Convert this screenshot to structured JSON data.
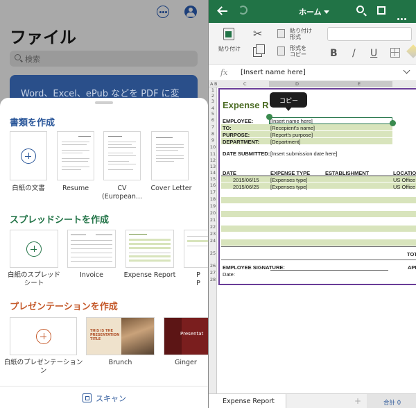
{
  "left": {
    "title": "ファイル",
    "search_placeholder": "検索",
    "banner_text": "Word、Excel、ePub などを PDF に変",
    "sections": {
      "documents": {
        "title": "書類を作成",
        "items": [
          {
            "label": "白紙の文書"
          },
          {
            "label": "Resume"
          },
          {
            "label": "CV",
            "label2": "(European..."
          },
          {
            "label": "Cover Letter"
          }
        ]
      },
      "spreadsheets": {
        "title": "スプレッドシートを作成",
        "items": [
          {
            "label": "白紙のスプレッド",
            "label2": "シート"
          },
          {
            "label": "Invoice"
          },
          {
            "label": "Expense Report"
          },
          {
            "label": "P",
            "label2": "P"
          }
        ]
      },
      "presentations": {
        "title": "プレゼンテーションを作成",
        "items": [
          {
            "label": "白紙のプレゼンテーション",
            "label2": "ン"
          },
          {
            "label": "Brunch",
            "thumb_text": "THIS IS THE PRESENTATION TITLE"
          },
          {
            "label": "Ginger",
            "thumb_text": "Presentat"
          }
        ]
      }
    },
    "scan_label": "スキャン"
  },
  "right": {
    "toolbar": {
      "home_label": "ホーム"
    },
    "ribbon": {
      "paste_label": "貼り付け",
      "paste_format_label1": "貼り付け",
      "paste_format_label2": "形式",
      "format_copy_label1": "形式を",
      "format_copy_label2": "コピー",
      "bold": "B",
      "italic": "/",
      "underline": "U"
    },
    "formula": {
      "fx": "fx",
      "value": "[Insert name here]"
    },
    "columns": {
      "a": "A",
      "b": "B",
      "c": "C",
      "d": "D",
      "e": "E"
    },
    "rows": [
      "1",
      "2",
      "3",
      "4",
      "5",
      "6",
      "7",
      "8",
      "9",
      "10",
      "11",
      "12",
      "13",
      "14",
      "15",
      "16",
      "17",
      "18",
      "19",
      "20",
      "21",
      "22",
      "23",
      "24",
      "25",
      "26",
      "27",
      "28"
    ],
    "tooltip": "コピー",
    "sheet": {
      "title": "Expense R",
      "employee_label": "EMPLOYEE:",
      "employee_value": "[Insert name here]",
      "to_label": "TO:",
      "to_value": "[Recepient's name]",
      "purpose_label": "PURPOSE:",
      "purpose_value": "[Report's purpose]",
      "department_label": "DEPARTMENT:",
      "department_value": "[Department]",
      "date_submitted_label": "DATE SUBMITTED:",
      "date_submitted_value": "[Insert submission date here]",
      "table_headers": {
        "date": "DATE",
        "type": "EXPENSE TYPE",
        "establishment": "ESTABLISHMENT",
        "location": "LOCATIO"
      },
      "rows": [
        {
          "date": "2015/06/15",
          "type": "[Expenses type]",
          "location": "US Office"
        },
        {
          "date": "2015/06/25",
          "type": "[Expenses type]",
          "location": "US Office"
        }
      ],
      "total_label": "TOT",
      "signature_label": "EMPLOYEE SIGNATURE:",
      "approved_label": "APP",
      "date_label": "Date:"
    },
    "tabs": {
      "active": "Expense Report",
      "add": "+",
      "sum": "合計 0"
    }
  },
  "colors": {
    "excel_green": "#217346",
    "word_blue": "#2b579a",
    "ppt_orange": "#c55a2b",
    "sheet_frame": "#6a3c98",
    "band": "#d8e4bc"
  }
}
